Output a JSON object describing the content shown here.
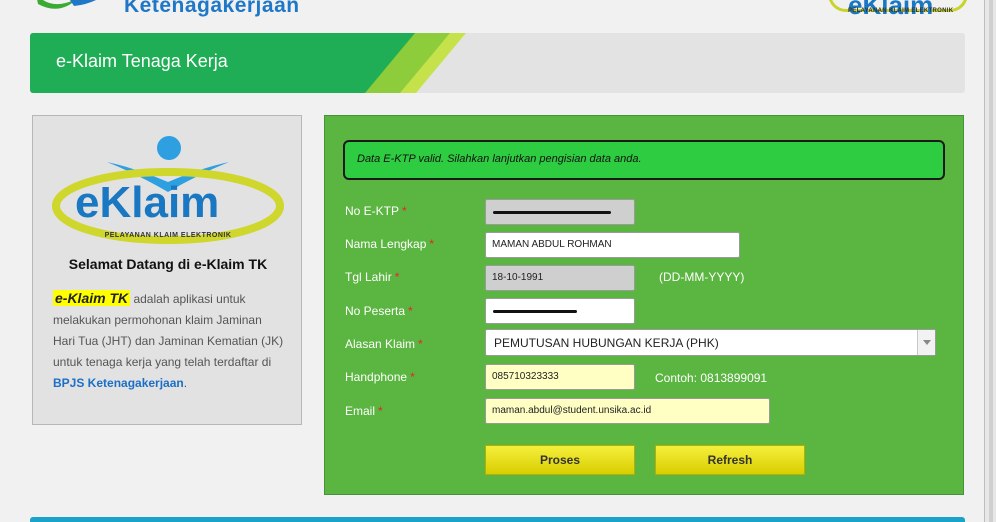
{
  "header": {
    "brand": "Ketenagakerjaan",
    "logo_word": "eKlaim",
    "logo_tag": "PELAYANAN KLAIM ELEKTRONIK"
  },
  "banner": {
    "title": "e-Klaim Tenaga Kerja"
  },
  "welcome_card": {
    "logo_word": "eKlaim",
    "logo_tag": "PELAYANAN KLAIM ELEKTRONIK",
    "heading": "Selamat Datang di e-Klaim TK",
    "highlight": "e-Klaim TK",
    "description": " adalah aplikasi untuk melakukan permohonan klaim Jaminan Hari Tua (JHT) dan Jaminan Kematian (JK) untuk tenaga kerja yang telah terdaftar di ",
    "link": "BPJS Ketenagakerjaan",
    "suffix": "."
  },
  "form": {
    "alert": "Data E-KTP valid. Silahkan lanjutkan pengisian data anda.",
    "fields": {
      "ektp": {
        "label": "No E-KTP",
        "value": ""
      },
      "nama": {
        "label": "Nama Lengkap",
        "value": "MAMAN ABDUL ROHMAN"
      },
      "tgl_lahir": {
        "label": "Tgl Lahir",
        "value": "18-10-1991",
        "hint": "(DD-MM-YYYY)"
      },
      "peserta": {
        "label": "No Peserta",
        "value": ""
      },
      "alasan": {
        "label": "Alasan Klaim",
        "value": "PEMUTUSAN HUBUNGAN KERJA (PHK)"
      },
      "handphone": {
        "label": "Handphone",
        "value": "085710323333",
        "hint": "Contoh: 0813899091"
      },
      "email": {
        "label": "Email",
        "value": "maman.abdul@student.unsika.ac.id"
      }
    },
    "required_mark": "*",
    "buttons": {
      "proses": "Proses",
      "refresh": "Refresh"
    }
  },
  "colors": {
    "panel_green": "#5bb541",
    "alert_green": "#2ecc40",
    "brand_blue": "#1f77c8",
    "button_yellow": "#e8e000",
    "required_red": "#e8242b"
  }
}
